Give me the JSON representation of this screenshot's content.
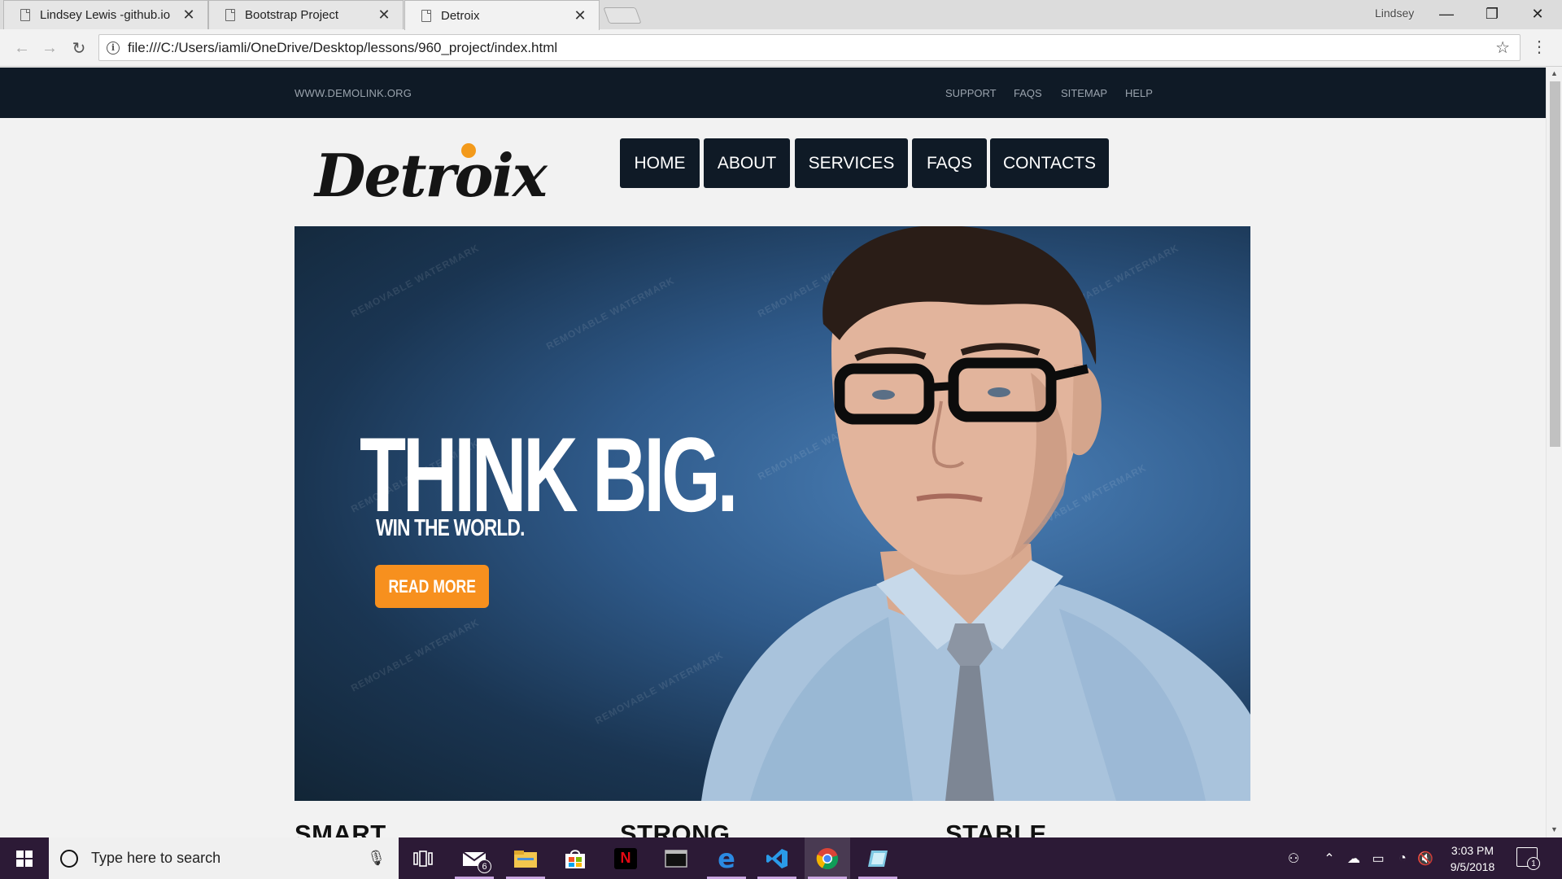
{
  "browser": {
    "tabs": [
      {
        "title": "Lindsey Lewis -github.io",
        "close": "✕"
      },
      {
        "title": "Bootstrap Project",
        "close": "✕"
      },
      {
        "title": "Detroix",
        "close": "✕"
      }
    ],
    "profile_name": "Lindsey",
    "window_controls": {
      "minimize": "—",
      "restore": "❐",
      "close": "✕"
    },
    "url": "file:///C:/Users/iamli/OneDrive/Desktop/lessons/960_project/index.html",
    "info_icon": "i",
    "back": "←",
    "forward": "→",
    "reload": "↻",
    "star": "☆",
    "menu": "⋮"
  },
  "site": {
    "topbar": {
      "site_link": "WWW.DEMOLINK.ORG",
      "links": [
        "SUPPORT",
        "FAQS",
        "SITEMAP",
        "HELP"
      ]
    },
    "logo": {
      "text": "Detroix",
      "dot_color": "#f39a1b"
    },
    "nav": [
      "HOME",
      "ABOUT",
      "SERVICES",
      "FAQS",
      "CONTACTS"
    ],
    "hero": {
      "headline": "THINK BIG.",
      "subheadline": "WIN THE WORLD.",
      "button": "READ MORE",
      "button_color": "#f7901e",
      "watermark": "REMOVABLE WATERMARK"
    },
    "columns": [
      "SMART",
      "STRONG",
      "STABLE"
    ]
  },
  "taskbar": {
    "search_placeholder": "Type here to search",
    "mail_badge": "6",
    "netflix_letter": "N",
    "edge_letter": "e",
    "clock_time": "3:03 PM",
    "clock_date": "9/5/2018",
    "notification_count": "1"
  },
  "colors": {
    "topbar_bg": "#0f1a26",
    "page_bg": "#f2f2f2",
    "taskbar_bg": "#2c1a36"
  }
}
